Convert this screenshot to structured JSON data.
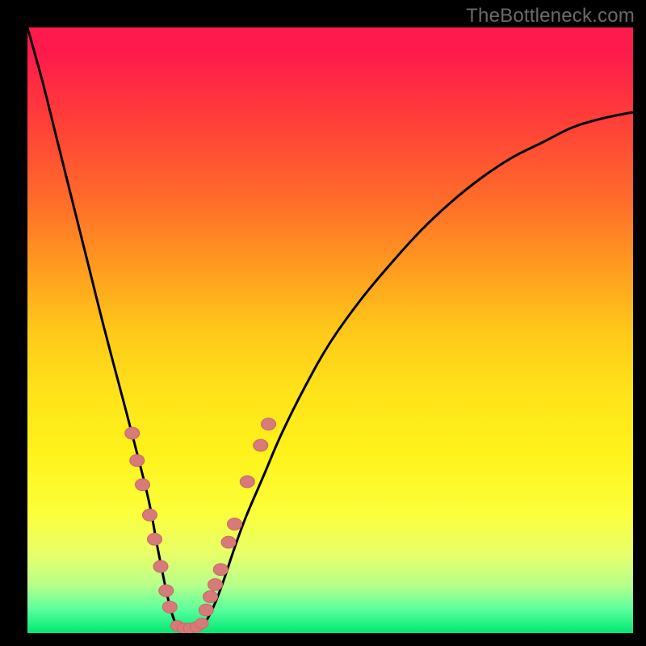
{
  "watermark": "TheBottleneck.com",
  "colors": {
    "frame": "#000000",
    "curve": "#000000",
    "marker_fill": "#d97a7a",
    "marker_stroke": "#c76868",
    "gradient_stops": [
      "#ff1a4d",
      "#ff3a3a",
      "#ff6a2a",
      "#ff9d1f",
      "#ffc81a",
      "#ffe21a",
      "#fff21a",
      "#fcff3a",
      "#e8ff6a",
      "#b8ff8a",
      "#5dff9d",
      "#00e874"
    ]
  },
  "chart_data": {
    "type": "line",
    "title": "",
    "xlabel": "",
    "ylabel": "",
    "xlim": [
      0,
      100
    ],
    "ylim": [
      0,
      100
    ],
    "grid": false,
    "legend": false,
    "x": [
      0,
      2.5,
      5,
      7.5,
      10,
      12.5,
      15,
      17.5,
      20,
      21.5,
      22.7,
      23.5,
      24.3,
      25.3,
      26.7,
      28,
      29.5,
      31,
      32.5,
      34,
      36,
      39,
      42,
      46,
      50,
      55,
      60,
      65,
      70,
      75,
      80,
      85,
      90,
      95,
      100
    ],
    "values": [
      100,
      91,
      81,
      71,
      61,
      51,
      41.5,
      32,
      22,
      14,
      8,
      4.5,
      2,
      0.6,
      0.3,
      0.6,
      2,
      5,
      9,
      13.5,
      19,
      26,
      33,
      41,
      48,
      55,
      61,
      66.5,
      71.2,
      75.2,
      78.5,
      81,
      83.5,
      85,
      86
    ],
    "markers_left": [
      {
        "x": 17.3,
        "y": 33
      },
      {
        "x": 18.1,
        "y": 28.5
      },
      {
        "x": 19.0,
        "y": 24.5
      },
      {
        "x": 20.2,
        "y": 19.5
      },
      {
        "x": 21.0,
        "y": 15.5
      },
      {
        "x": 22.0,
        "y": 11.0
      },
      {
        "x": 22.9,
        "y": 7.0
      },
      {
        "x": 23.5,
        "y": 4.3
      }
    ],
    "markers_right": [
      {
        "x": 29.5,
        "y": 3.8
      },
      {
        "x": 30.2,
        "y": 6.0
      },
      {
        "x": 31.0,
        "y": 8.0
      },
      {
        "x": 31.9,
        "y": 10.5
      },
      {
        "x": 33.2,
        "y": 15.0
      },
      {
        "x": 34.2,
        "y": 18.0
      },
      {
        "x": 36.3,
        "y": 25.0
      },
      {
        "x": 38.5,
        "y": 31.0
      },
      {
        "x": 39.8,
        "y": 34.5
      }
    ],
    "markers_bottom": [
      {
        "x": 24.7,
        "y": 1.2
      },
      {
        "x": 25.8,
        "y": 0.8
      },
      {
        "x": 26.8,
        "y": 0.8
      },
      {
        "x": 27.9,
        "y": 1.0
      },
      {
        "x": 28.8,
        "y": 1.6
      }
    ]
  }
}
